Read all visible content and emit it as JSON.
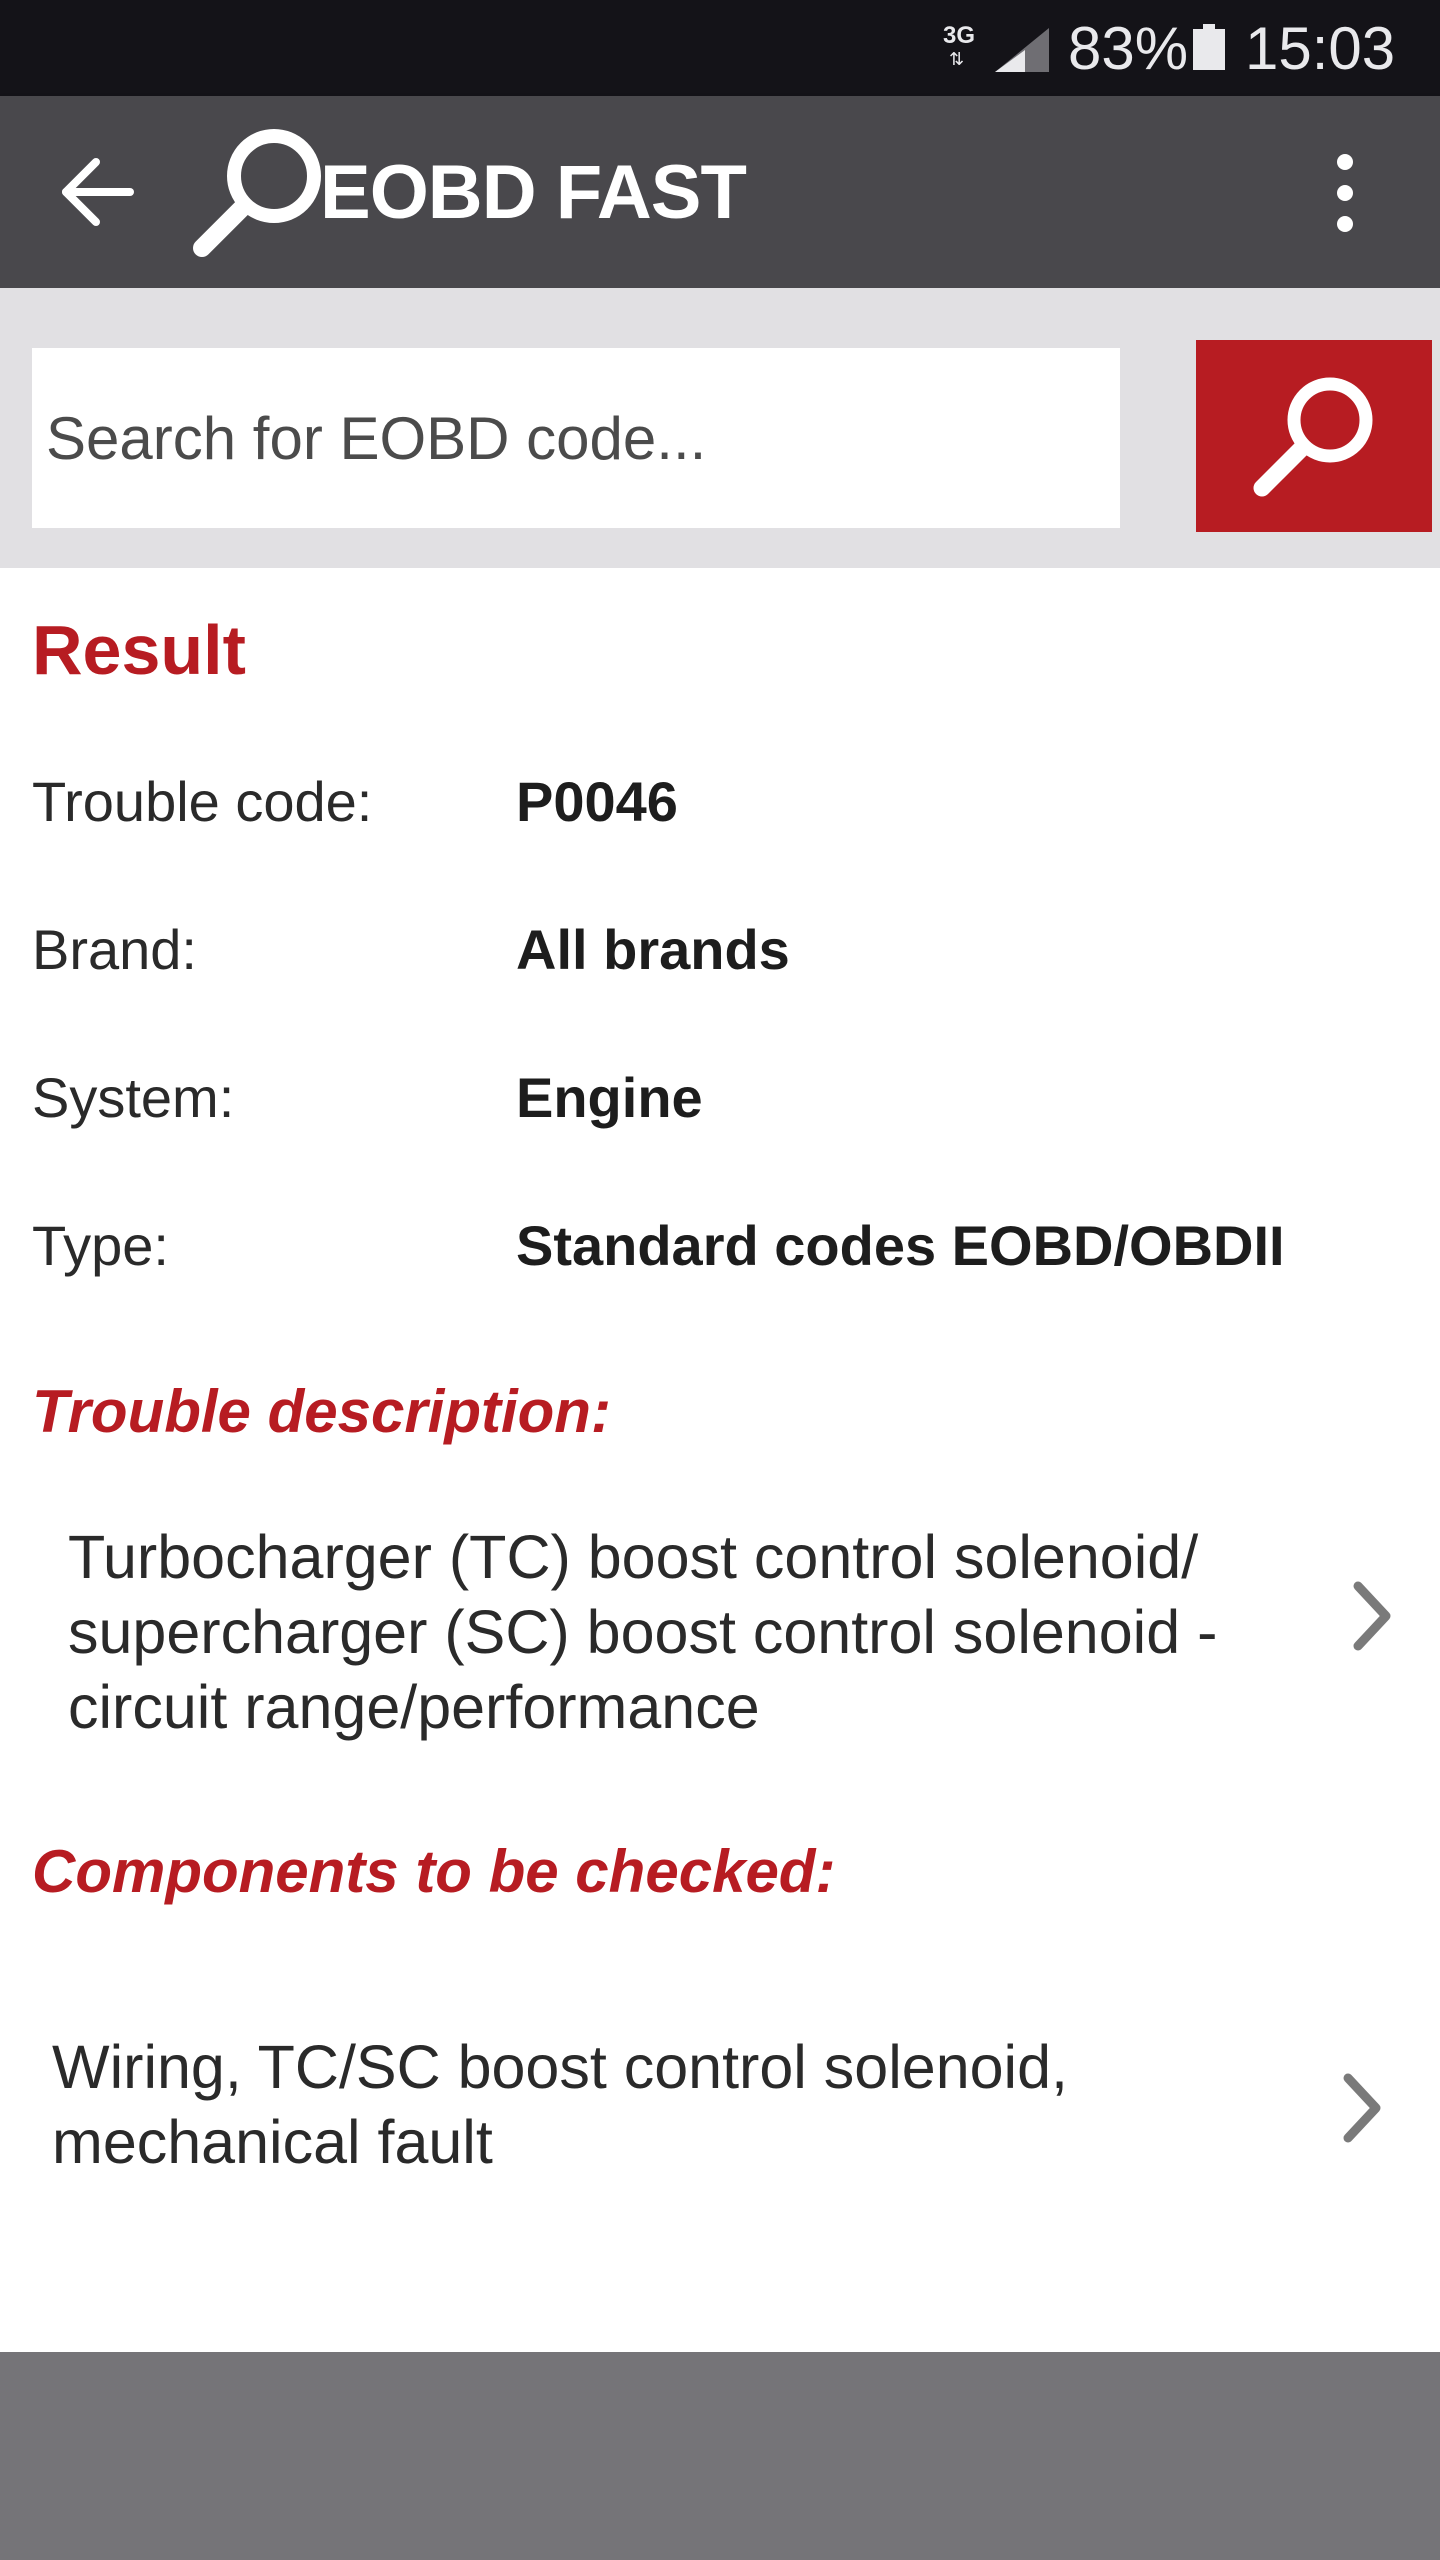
{
  "status_bar": {
    "network": "3G",
    "battery": "83%",
    "time": "15:03"
  },
  "app_bar": {
    "title": "EOBD FAST",
    "back_icon": "arrow-back-icon",
    "logo_icon": "magnifier-logo-icon",
    "menu_icon": "more-vert-icon"
  },
  "search": {
    "placeholder": "Search for EOBD code...",
    "button_icon": "search-icon"
  },
  "result": {
    "heading": "Result",
    "rows": [
      {
        "label": "Trouble code:",
        "value": "P0046"
      },
      {
        "label": "Brand:",
        "value": "All brands"
      },
      {
        "label": "System:",
        "value": "Engine"
      },
      {
        "label": "Type:",
        "value": "Standard codes EOBD/OBDII"
      }
    ]
  },
  "trouble_description": {
    "heading": "Trouble description:",
    "lines": [
      "Turbocharger (TC) boost control solenoid/",
      "supercharger (SC) boost control solenoid -",
      "circuit range/performance"
    ]
  },
  "components": {
    "heading": "Components to be checked:",
    "lines": [
      "Wiring, TC/SC boost control solenoid,",
      "mechanical fault"
    ]
  },
  "colors": {
    "accent": "#b71c22",
    "app_bar": "#49484c",
    "status_bar": "#141318",
    "search_strip": "#e1e0e3",
    "bottom_panel": "#757478"
  }
}
